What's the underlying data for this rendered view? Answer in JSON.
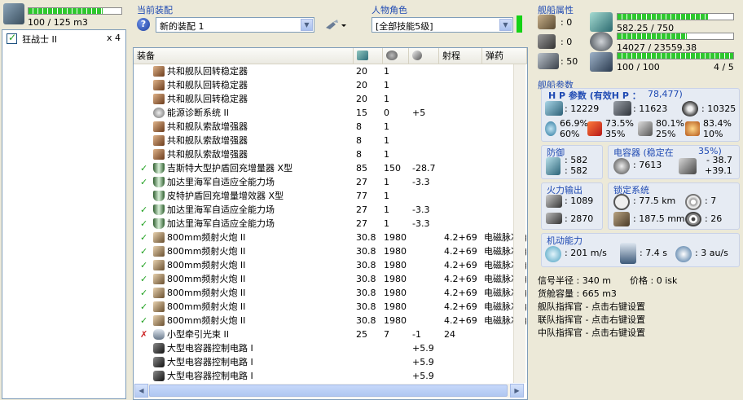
{
  "left": {
    "capacity": "100 / 125 m3",
    "capacity_fill": 0.8,
    "ship_entry": {
      "checked": true,
      "name": "狂战士 II",
      "count": "x 4"
    }
  },
  "loadout": {
    "label": "当前装配",
    "selected": "新的装配 1"
  },
  "character": {
    "label": "人物角色",
    "selected": "[全部技能5级]"
  },
  "grid": {
    "columns": [
      "装备",
      "",
      "",
      "",
      "射程",
      "弹药"
    ],
    "rows": [
      {
        "status": "none",
        "icon": "stabilizer",
        "name": "共和舰队回转稳定器",
        "c1": "20",
        "c2": "1",
        "c3": "",
        "range": "",
        "ammo": ""
      },
      {
        "status": "none",
        "icon": "stabilizer",
        "name": "共和舰队回转稳定器",
        "c1": "20",
        "c2": "1",
        "c3": "",
        "range": "",
        "ammo": ""
      },
      {
        "status": "none",
        "icon": "stabilizer",
        "name": "共和舰队回转稳定器",
        "c1": "20",
        "c2": "1",
        "c3": "",
        "range": "",
        "ammo": ""
      },
      {
        "status": "none",
        "icon": "diagnostic",
        "name": "能源诊断系统 II",
        "c1": "15",
        "c2": "0",
        "c3": "+5",
        "range": "",
        "ammo": ""
      },
      {
        "status": "none",
        "icon": "stabilizer",
        "name": "共和舰队索敌增强器",
        "c1": "8",
        "c2": "1",
        "c3": "",
        "range": "",
        "ammo": ""
      },
      {
        "status": "none",
        "icon": "stabilizer",
        "name": "共和舰队索敌增强器",
        "c1": "8",
        "c2": "1",
        "c3": "",
        "range": "",
        "ammo": ""
      },
      {
        "status": "none",
        "icon": "stabilizer",
        "name": "共和舰队索敌增强器",
        "c1": "8",
        "c2": "1",
        "c3": "",
        "range": "",
        "ammo": ""
      },
      {
        "status": "on",
        "icon": "shield",
        "name": "吉斯特大型护盾回充增量器 X型",
        "c1": "85",
        "c2": "150",
        "c3": "-28.7",
        "range": "",
        "ammo": ""
      },
      {
        "status": "on",
        "icon": "shield",
        "name": "加达里海军自适应全能力场",
        "c1": "27",
        "c2": "1",
        "c3": "-3.3",
        "range": "",
        "ammo": ""
      },
      {
        "status": "none",
        "icon": "shield",
        "name": "皮特护盾回充增量增效器 X型",
        "c1": "77",
        "c2": "1",
        "c3": "",
        "range": "",
        "ammo": ""
      },
      {
        "status": "on",
        "icon": "shield",
        "name": "加达里海军自适应全能力场",
        "c1": "27",
        "c2": "1",
        "c3": "-3.3",
        "range": "",
        "ammo": ""
      },
      {
        "status": "on",
        "icon": "shield",
        "name": "加达里海军自适应全能力场",
        "c1": "27",
        "c2": "1",
        "c3": "-3.3",
        "range": "",
        "ammo": ""
      },
      {
        "status": "on",
        "icon": "gun",
        "name": "800mm频射火炮 II",
        "c1": "30.8",
        "c2": "1980",
        "c3": "",
        "range": "4.2+69",
        "ammo": "电磁脉冲弹"
      },
      {
        "status": "on",
        "icon": "gun",
        "name": "800mm频射火炮 II",
        "c1": "30.8",
        "c2": "1980",
        "c3": "",
        "range": "4.2+69",
        "ammo": "电磁脉冲弹"
      },
      {
        "status": "on",
        "icon": "gun",
        "name": "800mm频射火炮 II",
        "c1": "30.8",
        "c2": "1980",
        "c3": "",
        "range": "4.2+69",
        "ammo": "电磁脉冲弹"
      },
      {
        "status": "on",
        "icon": "gun",
        "name": "800mm频射火炮 II",
        "c1": "30.8",
        "c2": "1980",
        "c3": "",
        "range": "4.2+69",
        "ammo": "电磁脉冲弹"
      },
      {
        "status": "on",
        "icon": "gun",
        "name": "800mm频射火炮 II",
        "c1": "30.8",
        "c2": "1980",
        "c3": "",
        "range": "4.2+69",
        "ammo": "电磁脉冲弹"
      },
      {
        "status": "on",
        "icon": "gun",
        "name": "800mm频射火炮 II",
        "c1": "30.8",
        "c2": "1980",
        "c3": "",
        "range": "4.2+69",
        "ammo": "电磁脉冲弹"
      },
      {
        "status": "on",
        "icon": "gun",
        "name": "800mm频射火炮 II",
        "c1": "30.8",
        "c2": "1980",
        "c3": "",
        "range": "4.2+69",
        "ammo": "电磁脉冲弹"
      },
      {
        "status": "off",
        "icon": "tractor",
        "name": "小型牵引光束 II",
        "c1": "25",
        "c2": "7",
        "c3": "-1",
        "range": "24",
        "ammo": ""
      },
      {
        "status": "none",
        "icon": "rig",
        "name": "大型电容器控制电路 I",
        "c1": "",
        "c2": "",
        "c3": "+5.9",
        "range": "",
        "ammo": ""
      },
      {
        "status": "none",
        "icon": "rig",
        "name": "大型电容器控制电路 I",
        "c1": "",
        "c2": "",
        "c3": "+5.9",
        "range": "",
        "ammo": ""
      },
      {
        "status": "none",
        "icon": "rig",
        "name": "大型电容器控制电路 I",
        "c1": "",
        "c2": "",
        "c3": "+5.9",
        "range": "",
        "ammo": ""
      }
    ]
  },
  "ship_attrs": {
    "title": "舰船属性",
    "hardpoints": {
      "turret": ": 0",
      "launcher": ": 0",
      "drone": ": 50"
    },
    "cpu": "582.25 / 750",
    "cpu_fill": 0.78,
    "power": "14027 / 23559.38",
    "power_fill": 0.6,
    "drone_bay": "100 / 100",
    "drone_bay_fill": 1.0,
    "slots": "4 / 5"
  },
  "ship_params": {
    "title": "舰船参数",
    "hp_title": "H P 参数 (有效H P ：",
    "hp_value": "78,477)",
    "shield_hp": ": 12229",
    "armor_hp": ": 11623",
    "hull_hp": ": 10325",
    "resists": [
      {
        "top": "66.9%",
        "bottom": "60%"
      },
      {
        "top": "73.5%",
        "bottom": "35%"
      },
      {
        "top": "80.1%",
        "bottom": "25%"
      },
      {
        "top": "83.4%",
        "bottom": "10%"
      }
    ]
  },
  "defense": {
    "title": "防御",
    "v1": ": 582",
    "v2": ": 582"
  },
  "capacitor": {
    "title": "电容器 (稳定在",
    "stable": "35%)",
    "cap": ": 7613",
    "delta1": "- 38.7",
    "delta2": "+39.1"
  },
  "firepower": {
    "title": "火力输出",
    "v1": ": 1089",
    "v2": ": 2870"
  },
  "targeting": {
    "title": "锁定系统",
    "range": ": 77.5 km",
    "targets": ": 7",
    "scan": ": 187.5 mm",
    "sensor": ": 26"
  },
  "mobility": {
    "title": "机动能力",
    "speed": ": 201 m/s",
    "align": ": 7.4 s",
    "warp": ": 3 au/s"
  },
  "misc": {
    "signature": "信号半径 : 340 m",
    "price": "价格 : 0 isk",
    "cargo": "货舱容量 : 665 m3",
    "fleet_booster": "舰队指挥官 - 点击右键设置",
    "wing_booster": "联队指挥官 - 点击右键设置",
    "squad_booster": "中队指挥官 - 点击右键设置"
  },
  "colors": {
    "accent": "#1f4ab3",
    "bar_green": "#2ec82e",
    "check": "#21a121",
    "cross": "#cc2222"
  }
}
